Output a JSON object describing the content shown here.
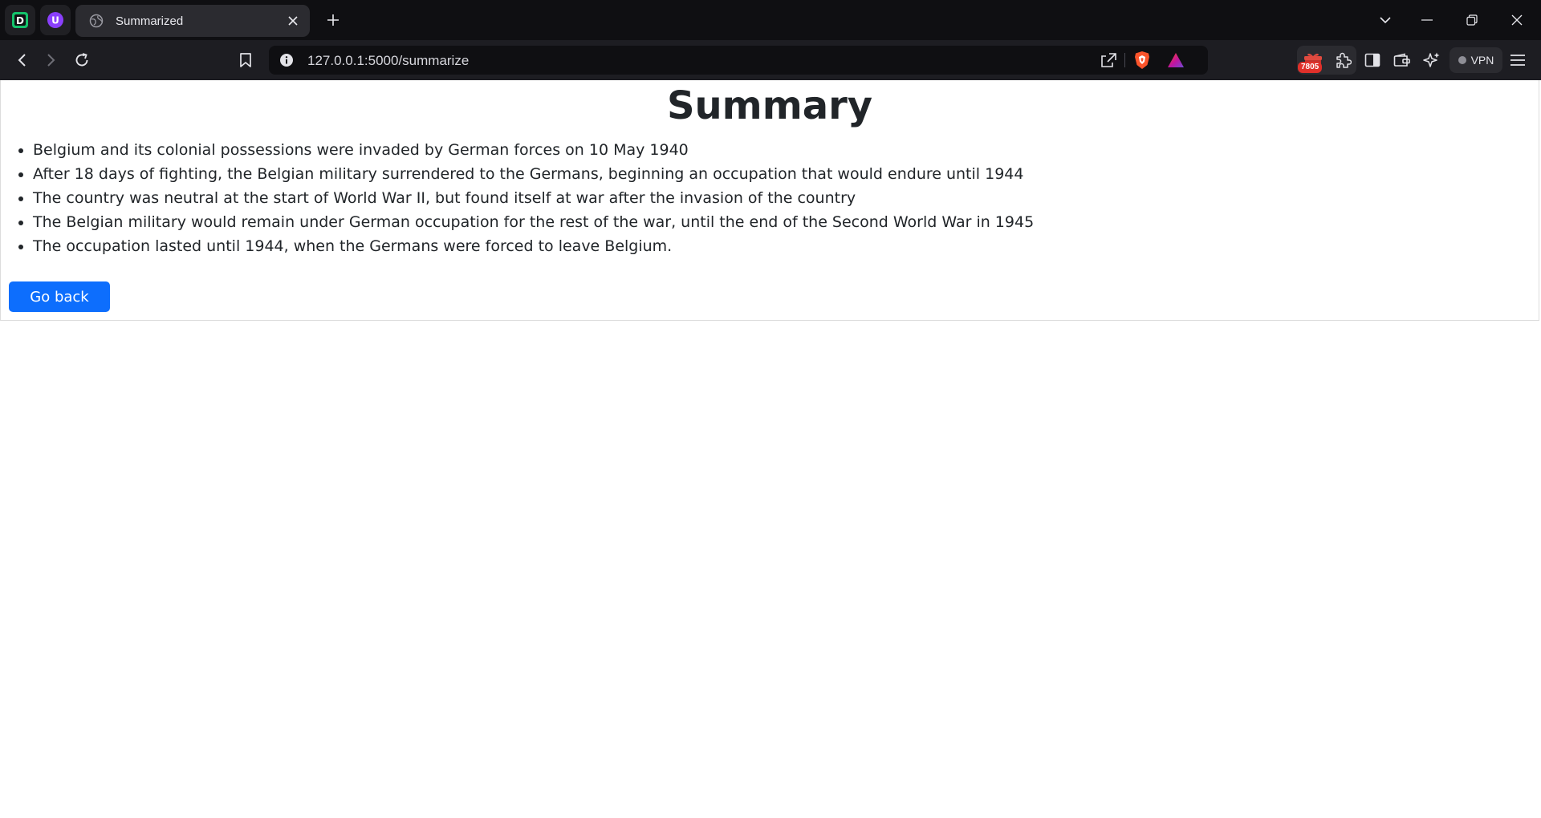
{
  "browser": {
    "pinned_tabs": [
      {
        "icon": "d-app-icon",
        "letter": "D",
        "color": "#14c26b"
      },
      {
        "icon": "u-app-icon",
        "letter": "U",
        "color": "#8a3ffc"
      }
    ],
    "tab": {
      "title": "Summarized",
      "icon": "globe-icon"
    },
    "address_bar": {
      "url": "127.0.0.1:5000/summarize"
    },
    "extensions": {
      "badge_count": "7805"
    },
    "vpn_label": "VPN",
    "accent_colors": {
      "brave_orange": "#fb542b",
      "badge_red": "#e0302a"
    }
  },
  "page": {
    "title": "Summary",
    "items": [
      "Belgium and its colonial possessions were invaded by German forces on 10 May 1940",
      "After 18 days of fighting, the Belgian military surrendered to the Germans, beginning an occupation that would endure until 1944",
      "The country was neutral at the start of World War II, but found itself at war after the invasion of the country",
      "The Belgian military would remain under German occupation for the rest of the war, until the end of the Second World War in 1945",
      "The occupation lasted until 1944, when the Germans were forced to leave Belgium."
    ],
    "go_back_label": "Go back",
    "button_color": "#0d6efd"
  }
}
